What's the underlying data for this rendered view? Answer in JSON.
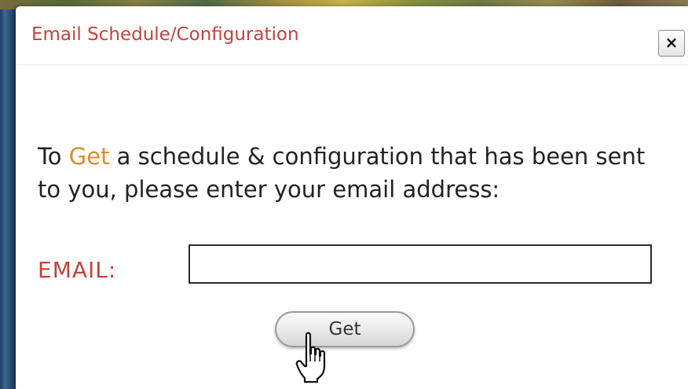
{
  "dialog": {
    "title": "Email Schedule/Configuration",
    "close_label": "×",
    "instructions": {
      "before": "To ",
      "highlight": "Get",
      "after": " a schedule & configuration that has been sent to you, please enter your email address:"
    },
    "email": {
      "label": "EMAIL:",
      "value": "",
      "placeholder": ""
    },
    "get_button_label": "Get"
  },
  "colors": {
    "title": "#c6403c",
    "highlight": "#e08a2a",
    "label": "#c6403c",
    "body_text": "#222222"
  },
  "icons": {
    "cursor": "hand-pointer-icon",
    "close": "close-icon"
  }
}
